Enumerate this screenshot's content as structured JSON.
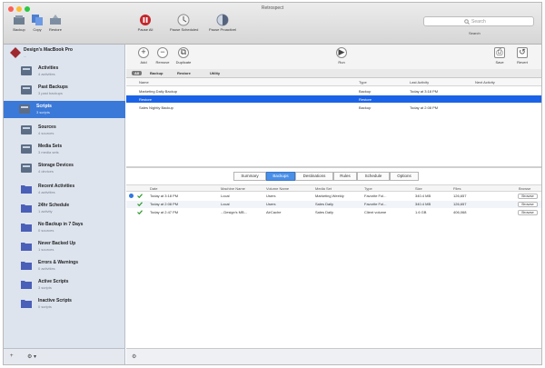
{
  "window": {
    "title": "Retrospect"
  },
  "toolbar": {
    "left": [
      {
        "label": "Backup",
        "icon": "backup-icon"
      },
      {
        "label": "Copy",
        "icon": "copy-icon"
      },
      {
        "label": "Restore",
        "icon": "restore-icon"
      }
    ],
    "center": [
      {
        "label": "Pause All",
        "icon": "pause-all-icon"
      },
      {
        "label": "Pause Scheduled",
        "icon": "pause-scheduled-icon"
      },
      {
        "label": "Pause ProactiveI",
        "icon": "pause-proactive-icon"
      }
    ],
    "search": {
      "placeholder": "Search",
      "label": "Search"
    }
  },
  "sidebar": {
    "device": {
      "name": "Design's MacBook Pro",
      "sub": "..."
    },
    "items": [
      {
        "name": "Activities",
        "sub": "4 activities",
        "icon": "activities-icon"
      },
      {
        "name": "Past Backups",
        "sub": "3 past backups",
        "icon": "past-backups-icon"
      },
      {
        "name": "Scripts",
        "sub": "3 scripts",
        "icon": "scripts-icon",
        "selected": true
      },
      {
        "name": "Sources",
        "sub": "4 sources",
        "icon": "sources-icon"
      },
      {
        "name": "Media Sets",
        "sub": "3 media sets",
        "icon": "media-sets-icon"
      },
      {
        "name": "Storage Devices",
        "sub": "4 devices",
        "icon": "storage-devices-icon"
      },
      {
        "name": "Recent Activities",
        "sub": "4 activities",
        "icon": "folder-icon"
      },
      {
        "name": "24hr Schedule",
        "sub": "1 activity",
        "icon": "folder-icon"
      },
      {
        "name": "No Backup in 7 Days",
        "sub": "0 sources",
        "icon": "folder-icon"
      },
      {
        "name": "Never Backed Up",
        "sub": "1 sources",
        "icon": "folder-icon"
      },
      {
        "name": "Errors & Warnings",
        "sub": "0 activities",
        "icon": "folder-icon"
      },
      {
        "name": "Active Scripts",
        "sub": "3 scripts",
        "icon": "folder-icon"
      },
      {
        "name": "Inactive Scripts",
        "sub": "0 scripts",
        "icon": "folder-icon"
      }
    ],
    "bottom": {
      "add": "+",
      "gear": "⚙ ▾"
    }
  },
  "scripts_toolbar": {
    "buttons": [
      {
        "label": "Add",
        "glyph": "+"
      },
      {
        "label": "Remove",
        "glyph": "−"
      },
      {
        "label": "Duplicate",
        "glyph": "⧉"
      },
      {
        "label": "Run",
        "glyph": "▶"
      },
      {
        "label": "Save",
        "glyph": "⎙"
      },
      {
        "label": "Revert",
        "glyph": "↺"
      }
    ],
    "filter_tabs": [
      "All",
      "Backup",
      "Restore",
      "Utility"
    ]
  },
  "scripts_table": {
    "headers": [
      "Name",
      "Type",
      "Last Activity",
      "Next Activity"
    ],
    "rows": [
      {
        "name": "Marketing Daily Backup",
        "type": "Backup",
        "last": "Today at 3:18 PM",
        "next": ""
      },
      {
        "name": "Restore",
        "type": "Restore",
        "last": "",
        "next": ""
      },
      {
        "name": "Sales Nightly Backup",
        "type": "Backup",
        "last": "Today at 2:08 PM",
        "next": ""
      }
    ]
  },
  "detail_tabs": [
    "Summary",
    "Backups",
    "Destinations",
    "Rules",
    "Schedule",
    "Options"
  ],
  "detail_table": {
    "headers": [
      "Date",
      "Machine Name",
      "Volume Name",
      "Media Set",
      "Type",
      "Size",
      "Files",
      "Browse"
    ],
    "rows": [
      {
        "date": "Today at 3:18 PM",
        "machine": "Local",
        "volume": "Users",
        "media": "Marketing Weekly",
        "type": "Favorite Fol...",
        "size": "340.4 MB",
        "files": "126,657",
        "browse": "Browse"
      },
      {
        "date": "Today at 2:08 PM",
        "machine": "Local",
        "volume": "Users",
        "media": "Sales Daily",
        "type": "Favorite Fol...",
        "size": "340.4 MB",
        "files": "126,657",
        "browse": "Browse"
      },
      {
        "date": "Today at 2:47 PM",
        "machine": "...Design's MB...",
        "volume": "AirCache",
        "media": "Sales Daily",
        "type": "Client volume",
        "size": "1.6 GB",
        "files": "406,068",
        "browse": "Browse"
      }
    ]
  },
  "colors": {
    "accent": "#1b63e6",
    "sidebar": "#dde4ee",
    "folder": "#4a5fb8"
  }
}
